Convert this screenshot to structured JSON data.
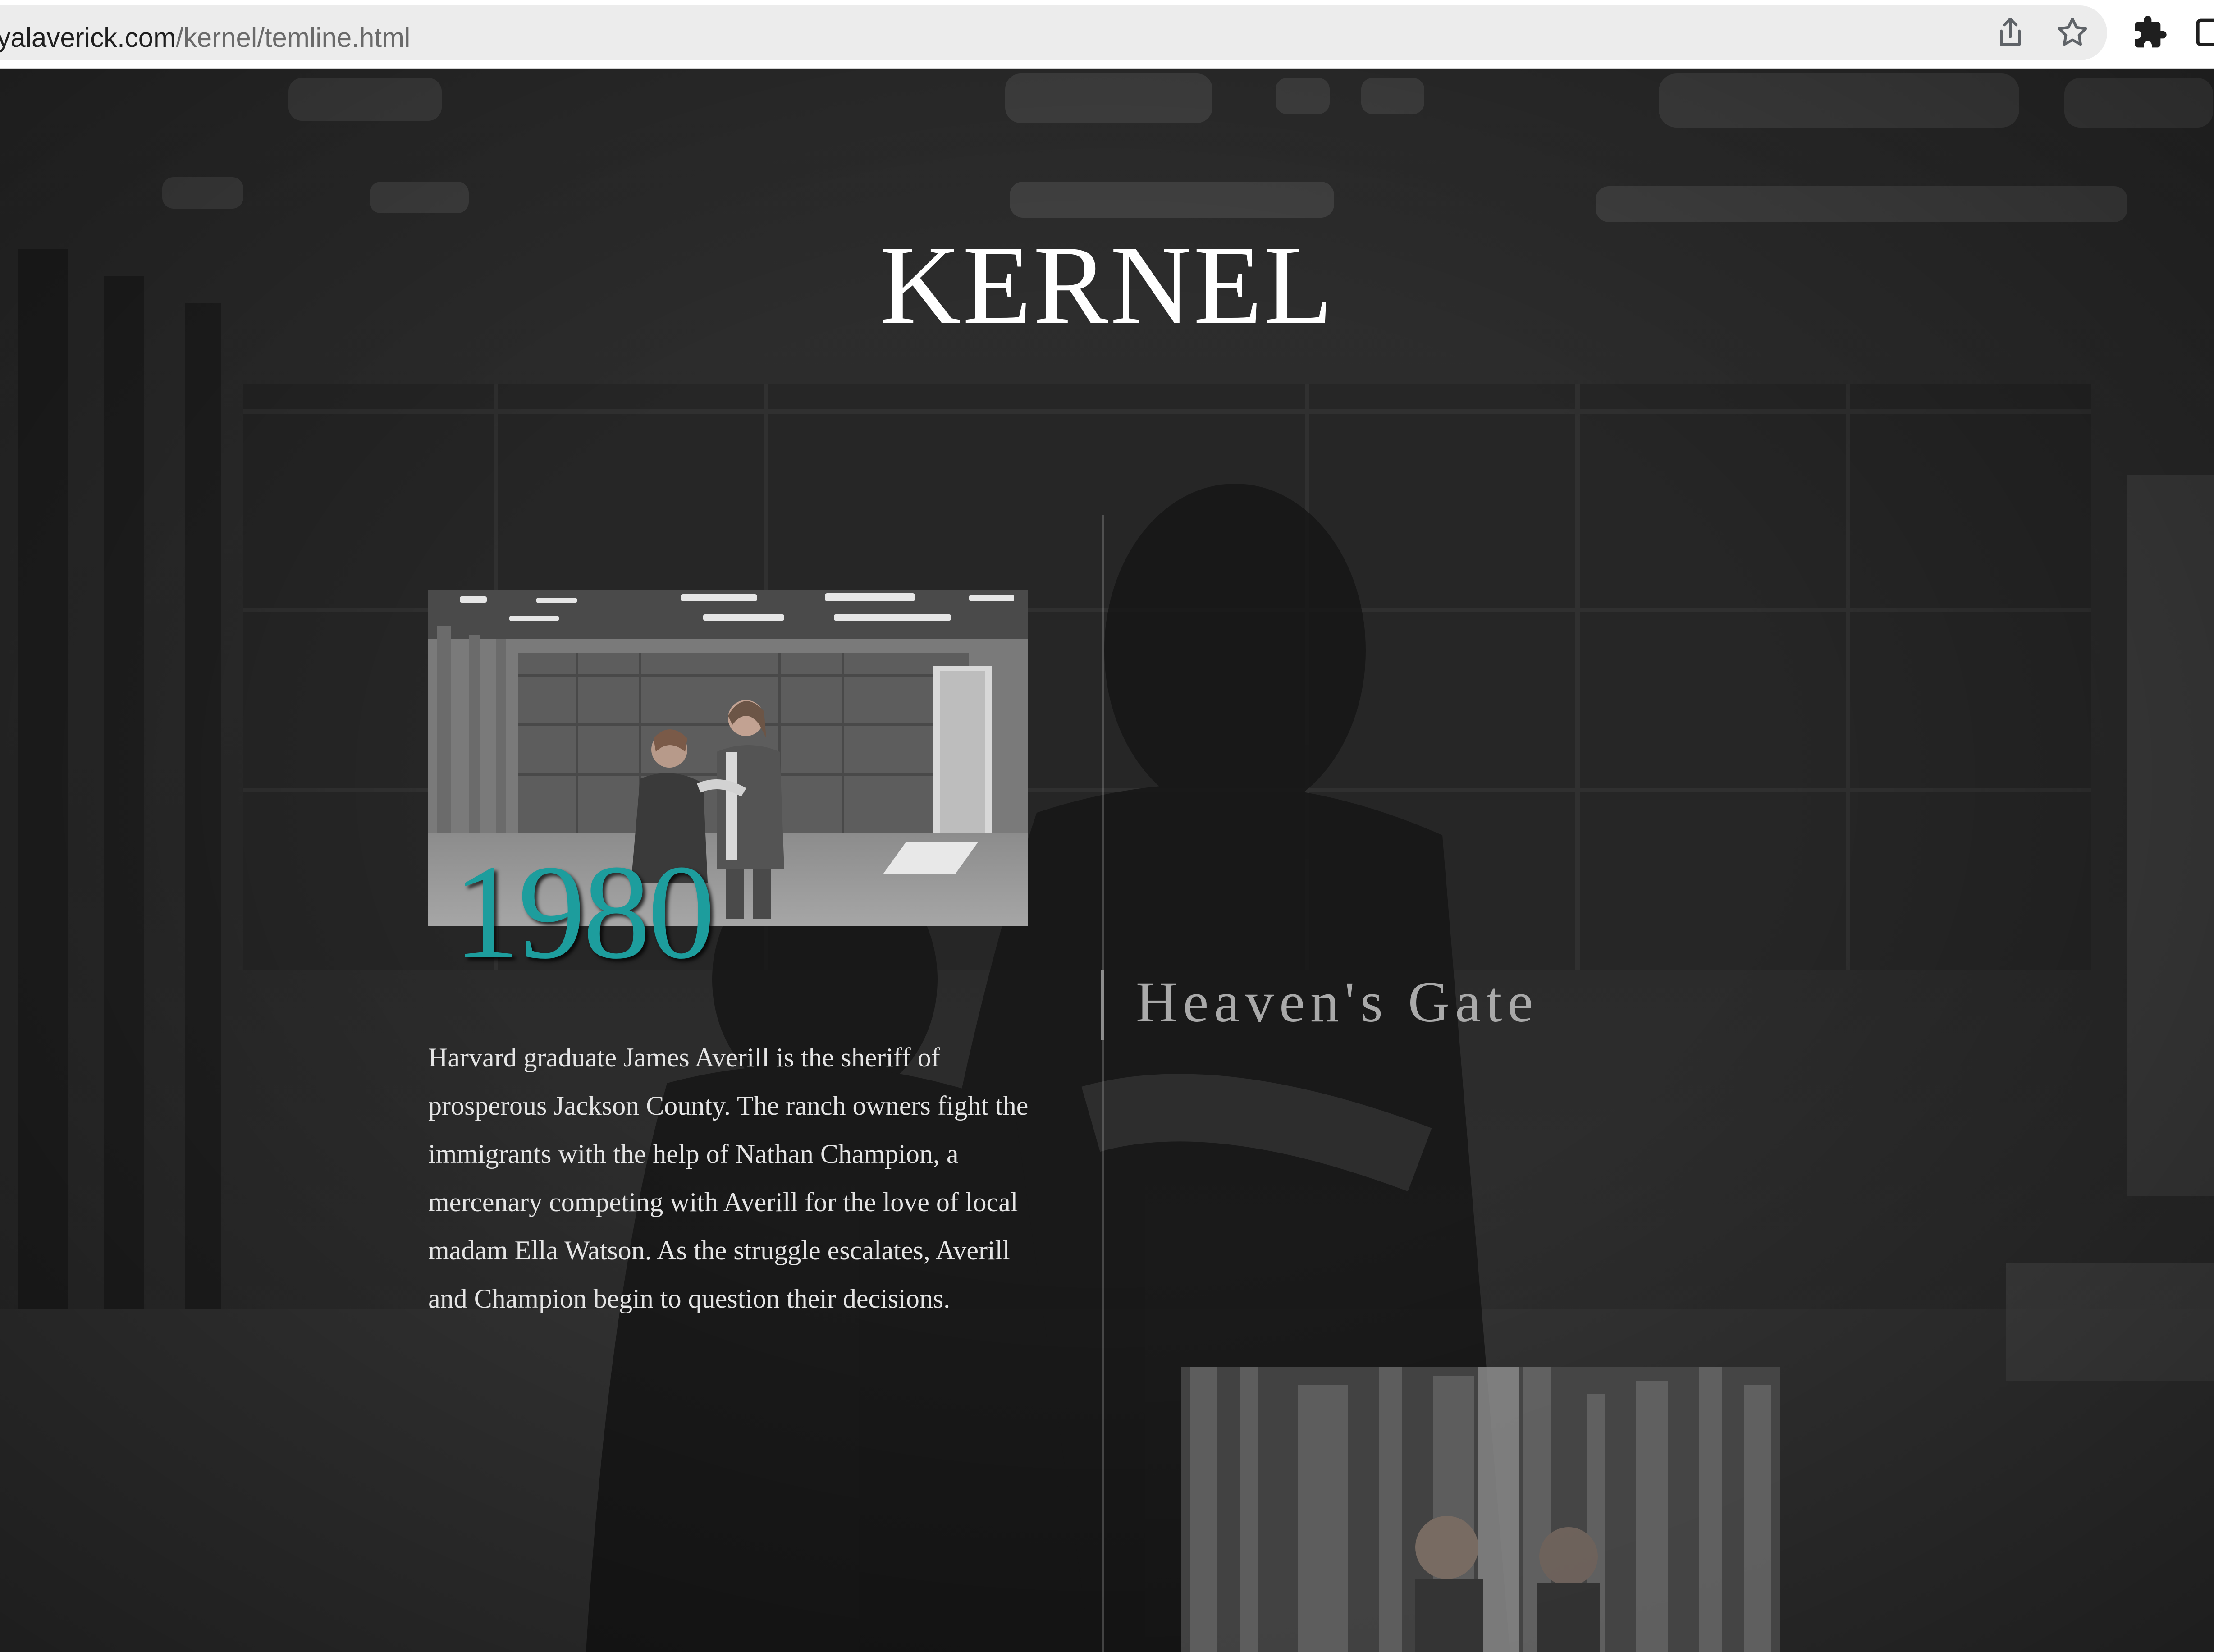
{
  "browser": {
    "url_host": "reyalaverick.com",
    "url_path": "/kernel/temline.html",
    "icons": [
      "share-icon",
      "bookmark-star-icon",
      "extensions-puzzle-icon",
      "window-icon"
    ]
  },
  "page": {
    "site_title": "KERNEL",
    "film": {
      "title": "Heaven's Gate",
      "year": "1980",
      "synopsis": "Harvard graduate James Averill is the sheriff of prosperous Jackson County. The ranch owners fight the immigrants with the help of Nathan Champion, a mercenary competing with Averill for the love of local madam Ella Watson. As the struggle escalates, Averill and Champion begin to question their decisions."
    }
  },
  "colors": {
    "accent_year": "#1d9d9d",
    "title": "#ffffff",
    "film_title": "#a9a9a9",
    "body_text": "#e4e4e4",
    "background": "#2b2b2b"
  }
}
